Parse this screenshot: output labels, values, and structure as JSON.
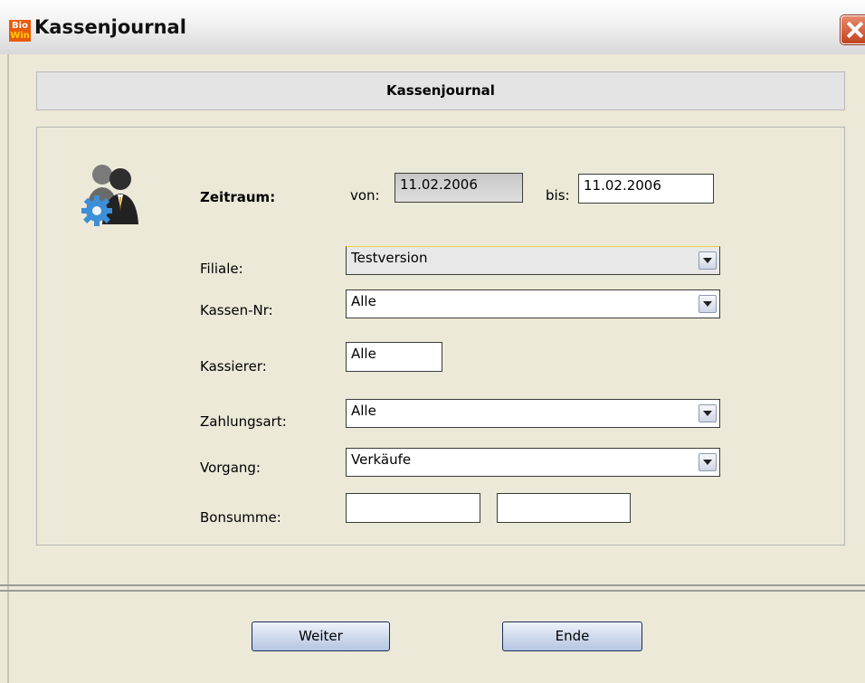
{
  "window": {
    "title": "Kassenjournal",
    "app_icon_line1": "Bio",
    "app_icon_line2": "Win"
  },
  "header": {
    "title": "Kassenjournal"
  },
  "form": {
    "zeitraum_label": "Zeitraum:",
    "von_label": "von:",
    "von_value": "11.02.2006",
    "bis_label": "bis:",
    "bis_value": "11.02.2006",
    "filiale_label": "Filiale:",
    "filiale_value": "Testversion",
    "kassen_nr_label": "Kassen-Nr:",
    "kassen_nr_value": "Alle",
    "kassierer_label": "Kassierer:",
    "kassierer_value": "Alle",
    "zahlungsart_label": "Zahlungsart:",
    "zahlungsart_value": "Alle",
    "vorgang_label": "Vorgang:",
    "vorgang_value": "Verkäufe",
    "bonsumme_label": "Bonsumme:",
    "bonsumme_from": "",
    "bonsumme_to": ""
  },
  "buttons": {
    "weiter": "Weiter",
    "ende": "Ende"
  },
  "icons": {
    "app": "app-logo-icon",
    "close": "close-icon",
    "users": "users-settings-icon",
    "dropdown": "chevron-down-icon"
  }
}
